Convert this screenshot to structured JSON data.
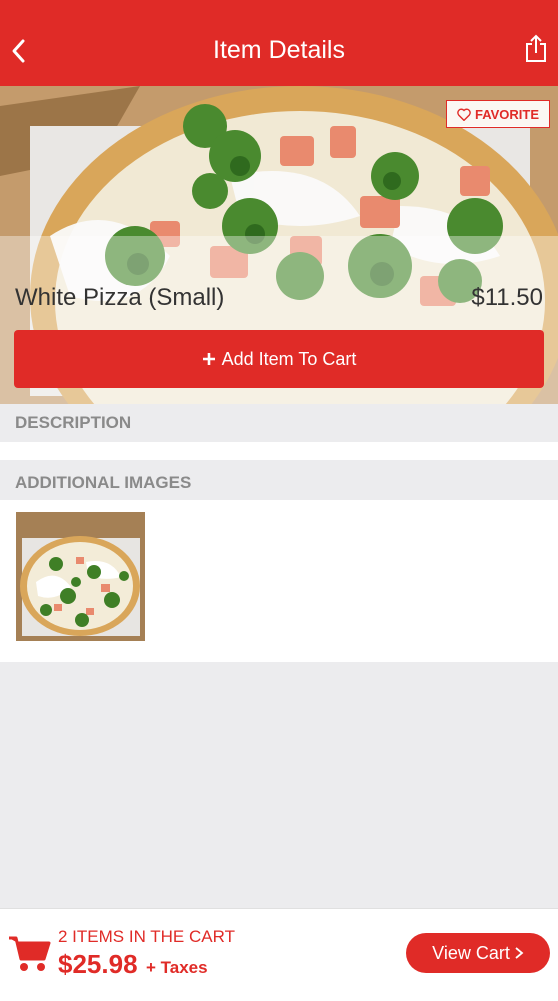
{
  "header": {
    "title": "Item Details",
    "back_icon": "chevron-left-icon",
    "share_icon": "share-icon"
  },
  "item": {
    "favorite_label": "FAVORITE",
    "name": "White Pizza (Small)",
    "price": "$11.50",
    "add_button_label": "Add Item To Cart"
  },
  "sections": {
    "description": "DESCRIPTION",
    "additional_images": "ADDITIONAL IMAGES"
  },
  "cart": {
    "count_text": "2 ITEMS IN THE CART",
    "total": "$25.98",
    "tax_note": "+ Taxes",
    "view_button_label": "View Cart"
  },
  "colors": {
    "brand": "#e02b27",
    "section_bg": "#ececee",
    "section_text": "#8a8a8a"
  }
}
